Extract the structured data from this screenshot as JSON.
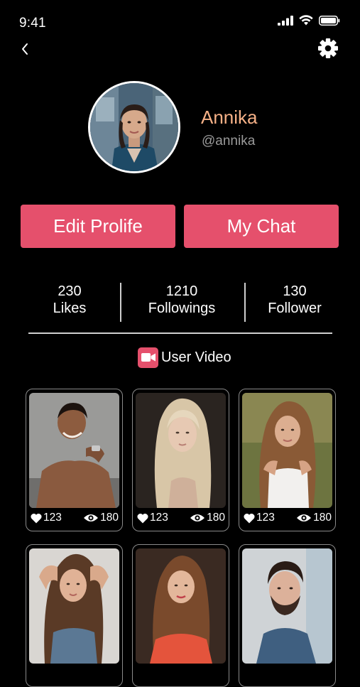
{
  "status_bar": {
    "time": "9:41",
    "icons": [
      "signal-icon",
      "wifi-icon",
      "battery-icon"
    ]
  },
  "header": {
    "back_icon": "chevron-left-icon",
    "settings_icon": "gear-icon"
  },
  "profile": {
    "name": "Annika",
    "handle": "@annika"
  },
  "actions": {
    "edit_label": "Edit Prolife",
    "chat_label": "My Chat"
  },
  "stats": [
    {
      "value": "230",
      "label": "Likes"
    },
    {
      "value": "1210",
      "label": "Followings"
    },
    {
      "value": "130",
      "label": "Follower"
    }
  ],
  "section": {
    "icon": "video-camera-icon",
    "title": "User Video"
  },
  "videos": [
    {
      "likes": "123",
      "views": "180"
    },
    {
      "likes": "123",
      "views": "180"
    },
    {
      "likes": "123",
      "views": "180"
    },
    {
      "likes": "",
      "views": ""
    },
    {
      "likes": "",
      "views": ""
    },
    {
      "likes": "",
      "views": ""
    }
  ],
  "colors": {
    "accent": "#e5506c",
    "name": "#f6b187",
    "handle": "#9a9a9a",
    "background": "#000000"
  }
}
